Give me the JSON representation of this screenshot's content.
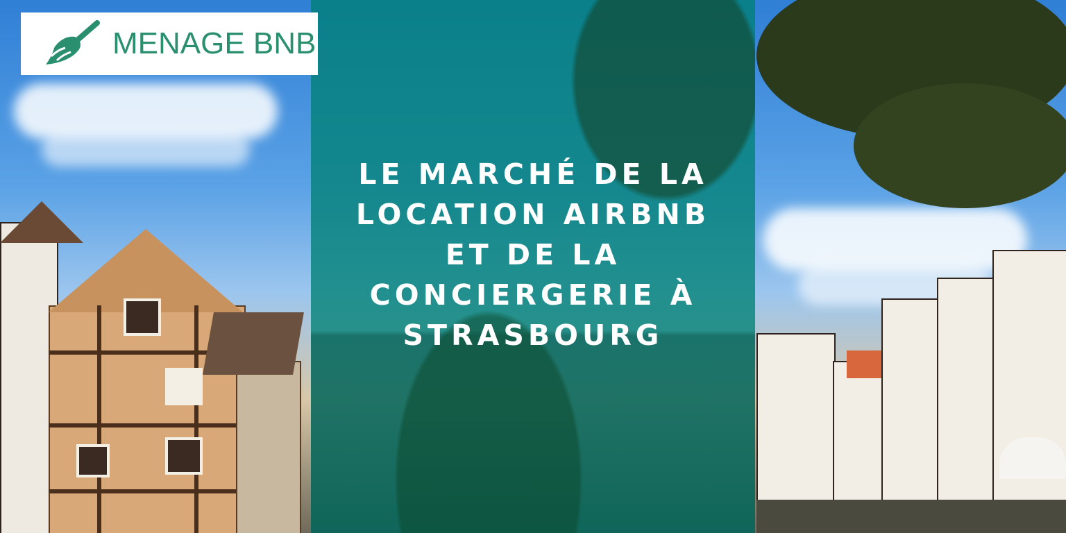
{
  "logo": {
    "text": "MENAGE BNB",
    "icon": "broom-icon",
    "color": "#2a8f6f"
  },
  "headline": {
    "lines": [
      "LE MARCHÉ DE LA",
      "LOCATION AIRBNB",
      "ET DE LA",
      "CONCIERGERIE À",
      "STRASBOURG"
    ]
  },
  "colors": {
    "overlay": "#008074",
    "text": "#ffffff"
  }
}
